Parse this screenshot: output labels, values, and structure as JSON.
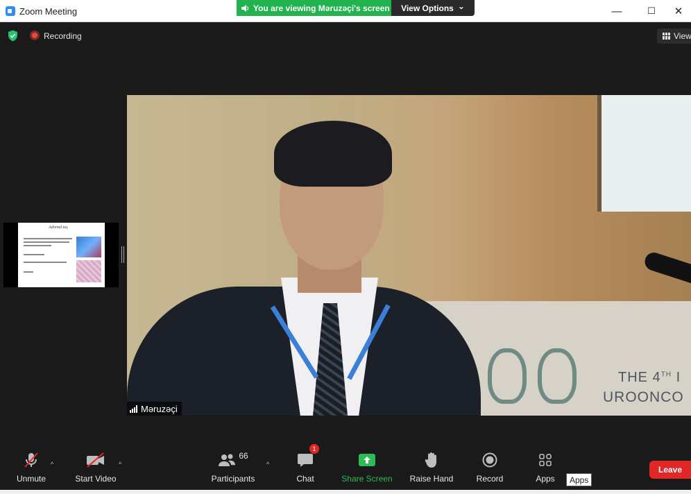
{
  "window": {
    "title": "Zoom Meeting",
    "minimize": "—",
    "maximize": "☐",
    "close": "✕"
  },
  "banner": {
    "viewing_text": "You are viewing Məruzəçi's screen",
    "view_options_label": "View Options",
    "view_options_caret": "⌄"
  },
  "topbar": {
    "recording_label": "Recording",
    "view_label": "View"
  },
  "video": {
    "participant_name": "Məruzəçi",
    "banner_line1": "THE 4",
    "banner_line1_sup": "TH",
    "banner_line1_rest": " I",
    "banner_line2": "UROONCO"
  },
  "thumbnail": {
    "slide_title": "Adrenal tuş"
  },
  "toolbar": {
    "unmute_label": "Unmute",
    "start_video_label": "Start Video",
    "participants_label": "Participants",
    "participants_count": "66",
    "chat_label": "Chat",
    "chat_badge": "1",
    "share_screen_label": "Share Screen",
    "raise_hand_label": "Raise Hand",
    "record_label": "Record",
    "apps_label": "Apps",
    "apps_tooltip": "Apps",
    "leave_label": "Leave",
    "caret": "^"
  },
  "colors": {
    "share_green": "#2dbb55",
    "leave_red": "#e02828",
    "banner_green": "#20b34e",
    "zoom_blue": "#2d8cff"
  }
}
